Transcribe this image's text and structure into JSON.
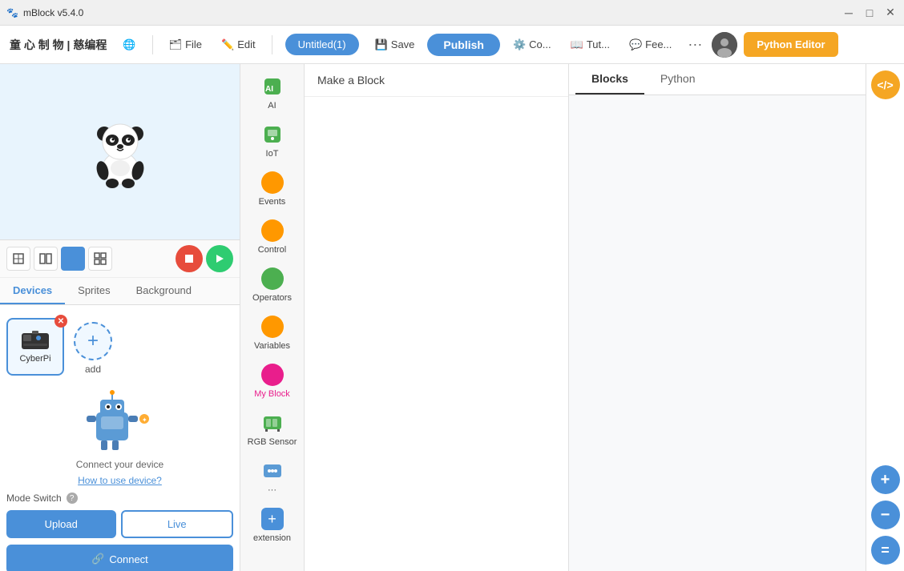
{
  "titlebar": {
    "app_name": "mBlock v5.4.0",
    "minimize": "─",
    "maximize": "□",
    "close": "✕"
  },
  "menubar": {
    "logo": "童 心 制 物 | 慈编程",
    "globe_icon": "🌐",
    "file_label": "File",
    "edit_label": "Edit",
    "project_name": "Untitled(1)",
    "save_icon": "💾",
    "save_label": "Save",
    "publish_label": "Publish",
    "connect_label": "Co...",
    "tutorial_label": "Tut...",
    "feedback_label": "Fee...",
    "more_label": "···",
    "python_editor_label": "Python Editor"
  },
  "stage_controls": {
    "layout_icons": [
      "⊞",
      "⊟",
      "⊠",
      "⊡"
    ],
    "stop_icon": "■",
    "run_icon": "▶"
  },
  "tabs": {
    "devices_label": "Devices",
    "sprites_label": "Sprites",
    "background_label": "Background"
  },
  "devices": {
    "device_name": "CyberPi",
    "add_label": "add",
    "connect_device_label": "Connect your device",
    "how_to_label": "How to use device?",
    "mode_switch_label": "Mode Switch",
    "upload_label": "Upload",
    "live_label": "Live",
    "connect_label": "Connect",
    "link_icon": "🔗"
  },
  "categories": [
    {
      "label": "AI",
      "color": "#4CAF50",
      "type": "icon"
    },
    {
      "label": "IoT",
      "color": "#4CAF50",
      "type": "icon"
    },
    {
      "label": "Events",
      "color": "#FF9800",
      "type": "dot"
    },
    {
      "label": "Control",
      "color": "#FF9800",
      "type": "dot"
    },
    {
      "label": "Operators",
      "color": "#4CAF50",
      "type": "dot"
    },
    {
      "label": "Variables",
      "color": "#FF9800",
      "type": "dot"
    },
    {
      "label": "My Block",
      "color": "#E91E8C",
      "type": "dot"
    },
    {
      "label": "RGB Sensor",
      "color": "#4CAF50",
      "type": "icon"
    },
    {
      "label": "···",
      "color": "#4CAF50",
      "type": "icon"
    },
    {
      "label": "extension",
      "color": "#4a90d9",
      "type": "plus"
    }
  ],
  "make_block": {
    "label": "Make a Block"
  },
  "code_panel": {
    "blocks_tab": "Blocks",
    "python_tab": "Python"
  },
  "right_tools": {
    "code_icon": "</>",
    "zoom_in": "+",
    "zoom_out": "−",
    "reset": "="
  }
}
